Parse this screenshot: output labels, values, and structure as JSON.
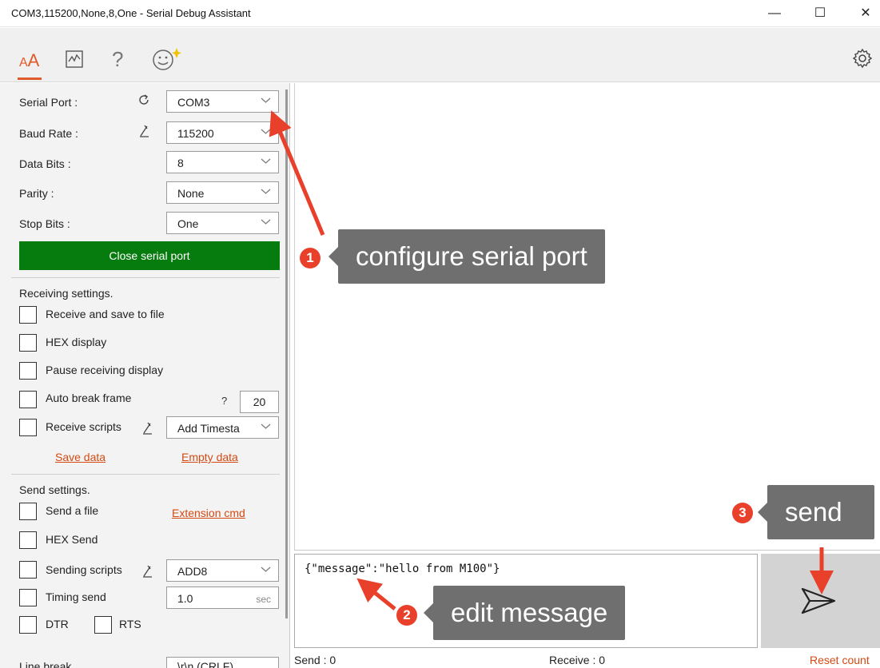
{
  "window": {
    "title": "COM3,115200,None,8,One - Serial Debug Assistant",
    "minimize": "—",
    "maximize": "☐",
    "close": "✕"
  },
  "toolbar": {
    "font_tab": "AA",
    "chart_icon": "chart-icon",
    "help": "?",
    "smiley_icon": "smiley-icon",
    "settings_icon": "gear-icon"
  },
  "port": {
    "serial_port_label": "Serial Port :",
    "serial_port_value": "COM3",
    "baud_rate_label": "Baud Rate :",
    "baud_rate_value": "115200",
    "data_bits_label": "Data Bits :",
    "data_bits_value": "8",
    "parity_label": "Parity :",
    "parity_value": "None",
    "stop_bits_label": "Stop Bits :",
    "stop_bits_value": "One",
    "close_button": "Close serial port"
  },
  "receiving": {
    "title": "Receiving settings.",
    "save_to_file": "Receive and save to file",
    "hex_display": "HEX display",
    "pause_display": "Pause receiving display",
    "auto_break": "Auto break frame",
    "auto_break_help": "?",
    "auto_break_value": "20",
    "receive_scripts": "Receive scripts",
    "script_value": "Add Timesta",
    "save_data": "Save data",
    "empty_data": "Empty data"
  },
  "sending": {
    "title": "Send settings.",
    "send_file": "Send a file",
    "extension_cmd": "Extension cmd",
    "hex_send": "HEX Send",
    "sending_scripts": "Sending scripts",
    "script_value": "ADD8",
    "timing_send": "Timing send",
    "timing_value": "1.0",
    "timing_unit": "sec",
    "dtr": "DTR",
    "rts": "RTS",
    "line_break_label": "Line break",
    "line_break_value": "\\r\\n (CRLF)"
  },
  "send_box": {
    "message": "{\"message\":\"hello from M100\"}"
  },
  "status": {
    "send": "Send : 0",
    "receive": "Receive : 0",
    "reset": "Reset count"
  },
  "annotations": {
    "step1_num": "1",
    "step1_text": "configure serial port",
    "step2_num": "2",
    "step2_text": "edit message",
    "step3_num": "3",
    "step3_text": "send"
  },
  "colors": {
    "accent": "#e05a2a",
    "close_button_bg": "#067b0e",
    "link": "#d44a14",
    "callout_bg": "#6f6f6f",
    "badge": "#e8402a",
    "arrow": "#e8402a"
  }
}
